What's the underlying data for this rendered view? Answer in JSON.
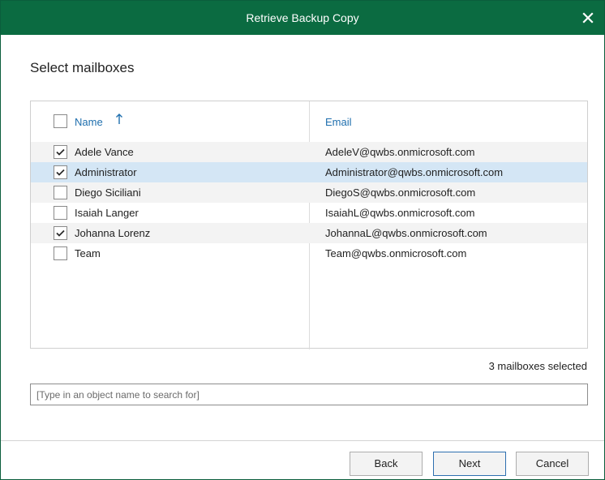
{
  "window": {
    "title": "Retrieve Backup Copy",
    "close_icon": "close-icon"
  },
  "page": {
    "heading": "Select mailboxes"
  },
  "table": {
    "columns": [
      {
        "label": "Name",
        "sort": "ascending",
        "sort_icon": "sort-up-arrow-icon"
      },
      {
        "label": "Email"
      }
    ],
    "rows": [
      {
        "name": "Adele Vance",
        "email": "AdeleV@qwbs.onmicrosoft.com",
        "checked": true,
        "selected": false
      },
      {
        "name": "Administrator",
        "email": "Administrator@qwbs.onmicrosoft.com",
        "checked": true,
        "selected": true
      },
      {
        "name": "Diego Siciliani",
        "email": "DiegoS@qwbs.onmicrosoft.com",
        "checked": false,
        "selected": false
      },
      {
        "name": "Isaiah Langer",
        "email": "IsaiahL@qwbs.onmicrosoft.com",
        "checked": false,
        "selected": false
      },
      {
        "name": "Johanna Lorenz",
        "email": "JohannaL@qwbs.onmicrosoft.com",
        "checked": true,
        "selected": false
      },
      {
        "name": "Team",
        "email": "Team@qwbs.onmicrosoft.com",
        "checked": false,
        "selected": false
      }
    ],
    "select_all_checked": false
  },
  "status": {
    "selected_text": "3 mailboxes selected"
  },
  "search": {
    "placeholder": "[Type in an object name to search for]",
    "value": ""
  },
  "buttons": {
    "back": "Back",
    "next": "Next",
    "cancel": "Cancel"
  },
  "colors": {
    "titlebar": "#0b6b41",
    "header_text": "#1f6fae",
    "selected_row": "#d4e6f5",
    "alt_row": "#f3f3f3"
  }
}
